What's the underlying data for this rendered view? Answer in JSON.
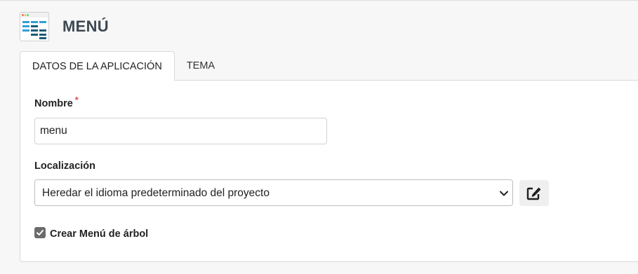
{
  "header": {
    "title": "MENÚ",
    "icon": "menu-app-icon"
  },
  "tabs": [
    {
      "label": "DATOS DE LA APLICACIÓN",
      "active": true
    },
    {
      "label": "TEMA",
      "active": false
    }
  ],
  "form": {
    "name": {
      "label": "Nombre",
      "required_mark": "*",
      "value": "menu"
    },
    "localization": {
      "label": "Localización",
      "selected": "Heredar el idioma predeterminado del proyecto",
      "edit_icon": "edit-icon"
    },
    "tree_menu": {
      "label": "Crear Menú de árbol",
      "checked": true
    }
  },
  "colors": {
    "title": "#3d4852",
    "required": "#d9534f",
    "icon_blue": "#2f9fd6",
    "icon_dark": "#1d5a78"
  }
}
